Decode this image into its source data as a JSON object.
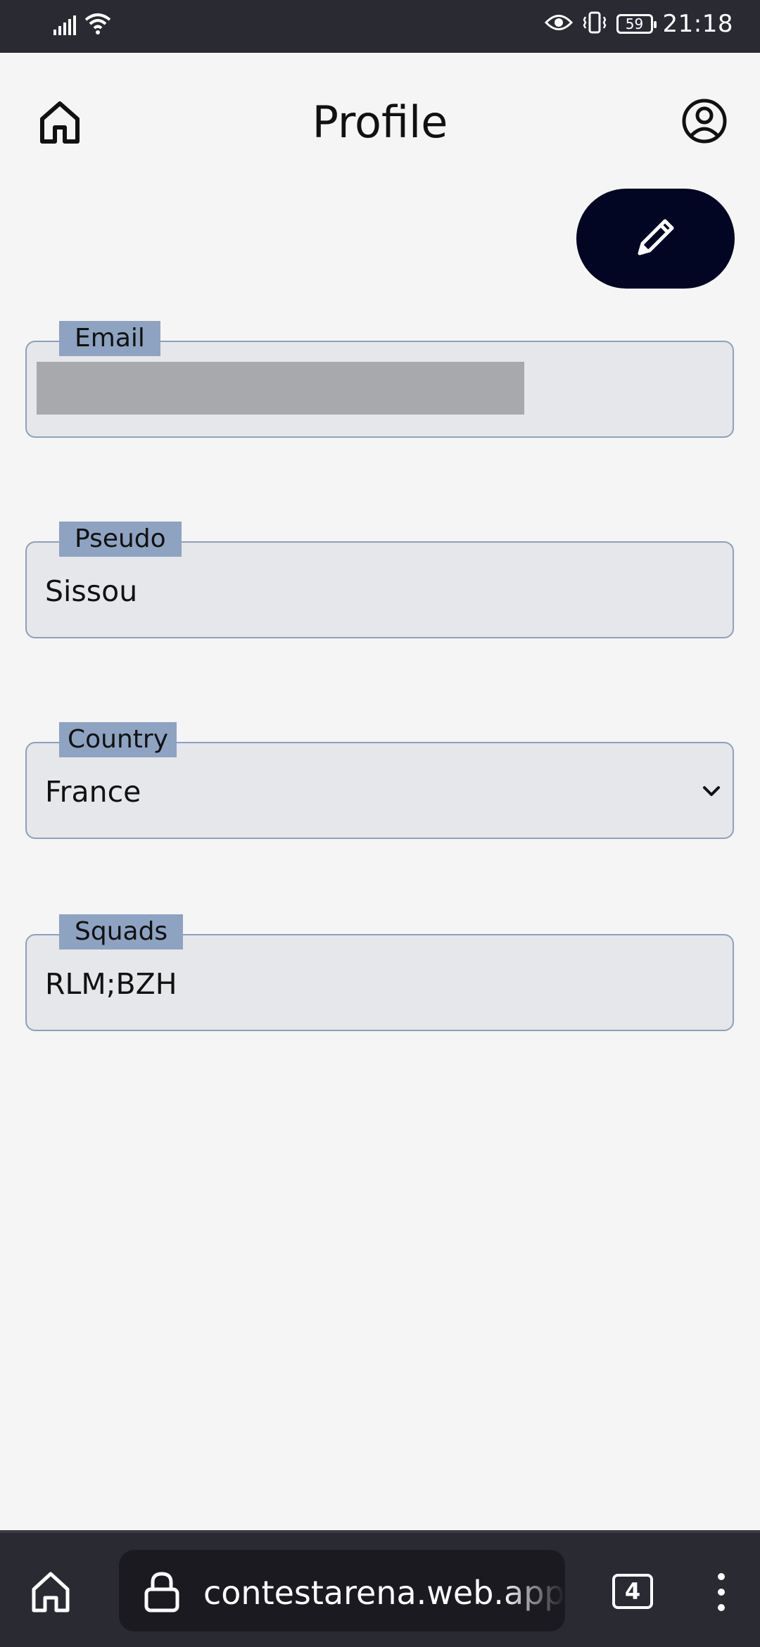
{
  "status_bar": {
    "time": "21:18",
    "battery": "59"
  },
  "header": {
    "title": "Profile"
  },
  "form": {
    "email": {
      "label": "Email",
      "value": ""
    },
    "pseudo": {
      "label": "Pseudo",
      "value": "Sissou"
    },
    "country": {
      "label": "Country",
      "value": "France"
    },
    "squads": {
      "label": "Squads",
      "value": "RLM;BZH"
    }
  },
  "browser": {
    "url": "contestarena.web.app/ide",
    "tab_count": "4"
  },
  "colors": {
    "accent_dark": "#030622",
    "field_border": "#8ea0bc",
    "label_bg": "#8ea3c1",
    "field_bg": "#e6e7ea",
    "page_bg": "#f5f5f5"
  },
  "icons": [
    "signal-icon",
    "wifi-icon",
    "eye-icon",
    "vibrate-icon",
    "battery-icon",
    "home-icon",
    "account-icon",
    "pencil-icon",
    "chevron-down-icon",
    "lock-icon",
    "tabs-icon",
    "more-icon"
  ]
}
